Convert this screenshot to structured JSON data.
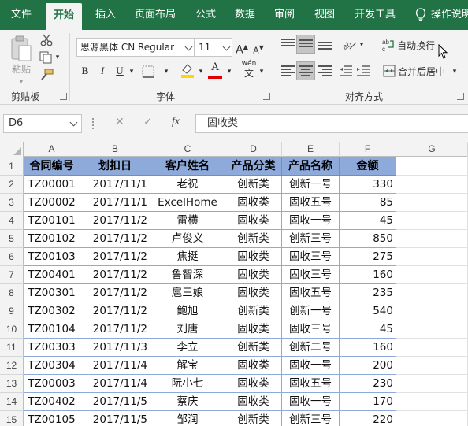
{
  "tabs": [
    {
      "label": "文件",
      "name": "tab-file"
    },
    {
      "label": "开始",
      "name": "tab-home",
      "active": true
    },
    {
      "label": "插入",
      "name": "tab-insert"
    },
    {
      "label": "页面布局",
      "name": "tab-page-layout"
    },
    {
      "label": "公式",
      "name": "tab-formulas"
    },
    {
      "label": "数据",
      "name": "tab-data"
    },
    {
      "label": "审阅",
      "name": "tab-review"
    },
    {
      "label": "视图",
      "name": "tab-view"
    },
    {
      "label": "开发工具",
      "name": "tab-developer"
    },
    {
      "label": "操作说明",
      "name": "tab-tell-me"
    }
  ],
  "ribbon": {
    "clipboard": {
      "paste_label": "粘贴",
      "group_label": "剪贴板"
    },
    "font": {
      "font_name": "思源黑体 CN Regular",
      "font_size": "11",
      "grow_label": "A",
      "shrink_label": "A",
      "bold_label": "B",
      "italic_label": "I",
      "underline_label": "U",
      "font_color_label": "A",
      "phonetic_label": "wén",
      "phonetic_sub": "文",
      "group_label": "字体"
    },
    "alignment": {
      "wrap_label": "自动换行",
      "merge_label": "合并后居中",
      "group_label": "对齐方式"
    },
    "colors": {
      "accent": "#217346",
      "table_header": "#8eaadb",
      "fill_yellow": "#ffd700",
      "font_red": "#e00000"
    }
  },
  "formula_bar": {
    "name_box": "D6",
    "cancel_symbol": "✕",
    "enter_symbol": "✓",
    "fx_label": "fx",
    "formula": "固收类"
  },
  "columns": [
    "A",
    "B",
    "C",
    "D",
    "E",
    "F",
    "G"
  ],
  "rows": [
    "1",
    "2",
    "3",
    "4",
    "5",
    "6",
    "7",
    "8",
    "9",
    "10",
    "11",
    "12",
    "13",
    "14",
    "15"
  ],
  "table": {
    "headers": [
      "合同编号",
      "划扣日",
      "客户姓名",
      "产品分类",
      "产品名称",
      "金额"
    ],
    "rows": [
      [
        "TZ00001",
        "2017/11/1",
        "老祝",
        "创新类",
        "创新一号",
        "330"
      ],
      [
        "TZ00002",
        "2017/11/1",
        "ExcelHome",
        "固收类",
        "固收五号",
        "85"
      ],
      [
        "TZ00101",
        "2017/11/2",
        "雷横",
        "固收类",
        "固收一号",
        "45"
      ],
      [
        "TZ00102",
        "2017/11/2",
        "卢俊义",
        "创新类",
        "创新三号",
        "850"
      ],
      [
        "TZ00103",
        "2017/11/2",
        "焦挺",
        "固收类",
        "固收三号",
        "275"
      ],
      [
        "TZ00401",
        "2017/11/2",
        "鲁智深",
        "固收类",
        "固收三号",
        "160"
      ],
      [
        "TZ00301",
        "2017/11/2",
        "扈三娘",
        "固收类",
        "固收五号",
        "235"
      ],
      [
        "TZ00302",
        "2017/11/2",
        "鲍旭",
        "创新类",
        "创新一号",
        "540"
      ],
      [
        "TZ00104",
        "2017/11/2",
        "刘唐",
        "固收类",
        "固收三号",
        "45"
      ],
      [
        "TZ00303",
        "2017/11/3",
        "李立",
        "创新类",
        "创新二号",
        "160"
      ],
      [
        "TZ00304",
        "2017/11/4",
        "解宝",
        "固收类",
        "固收一号",
        "200"
      ],
      [
        "TZ00003",
        "2017/11/4",
        "阮小七",
        "固收类",
        "固收五号",
        "230"
      ],
      [
        "TZ00402",
        "2017/11/5",
        "蔡庆",
        "固收类",
        "固收一号",
        "170"
      ],
      [
        "TZ00105",
        "2017/11/5",
        "邹润",
        "创新类",
        "创新三号",
        "220"
      ]
    ]
  }
}
